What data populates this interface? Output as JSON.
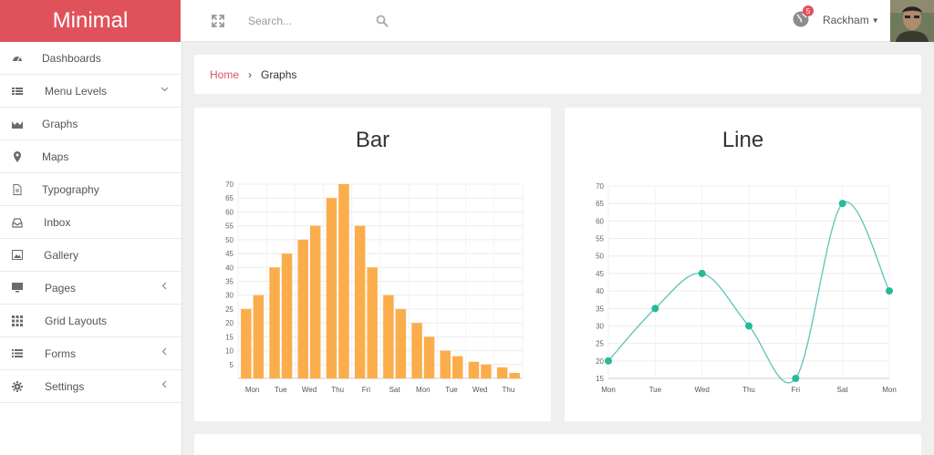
{
  "brand": {
    "title": "Minimal"
  },
  "sidebar": {
    "items": [
      {
        "label": "Dashboards",
        "icon": "dashboard-icon",
        "chevron": ""
      },
      {
        "label": "Menu Levels",
        "icon": "list-icon",
        "chevron": "⌵"
      },
      {
        "label": "Graphs",
        "icon": "area-chart-icon",
        "chevron": ""
      },
      {
        "label": "Maps",
        "icon": "map-marker-icon",
        "chevron": ""
      },
      {
        "label": "Typography",
        "icon": "file-text-icon",
        "chevron": ""
      },
      {
        "label": "Inbox",
        "icon": "inbox-icon",
        "chevron": ""
      },
      {
        "label": "Gallery",
        "icon": "picture-icon",
        "chevron": ""
      },
      {
        "label": "Pages",
        "icon": "desktop-icon",
        "chevron": "‹"
      },
      {
        "label": "Grid Layouts",
        "icon": "grid-icon",
        "chevron": ""
      },
      {
        "label": "Forms",
        "icon": "list-alt-icon",
        "chevron": "‹"
      },
      {
        "label": "Settings",
        "icon": "gear-icon",
        "chevron": "‹"
      }
    ]
  },
  "topbar": {
    "search_placeholder": "Search...",
    "notifications_count": "5",
    "user_name": "Rackham"
  },
  "breadcrumb": {
    "home": "Home",
    "current": "Graphs"
  },
  "colors": {
    "accent": "#e0525b",
    "bar": "#fbad4c",
    "line": "#5bc4b6",
    "point": "#26b99a"
  },
  "charts": [
    {
      "title": "Bar",
      "chart_data": {
        "type": "bar",
        "categories": [
          "Mon",
          "Tue",
          "Wed",
          "Thu",
          "Fri",
          "Sat",
          "Mon",
          "Tue",
          "Wed",
          "Thu"
        ],
        "series": [
          {
            "values": [
              25,
              40,
              50,
              65,
              55,
              30,
              20,
              10,
              6,
              4
            ]
          },
          {
            "values": [
              30,
              45,
              55,
              70,
              40,
              25,
              15,
              8,
              5,
              2
            ]
          }
        ],
        "yticks": [
          5,
          10,
          15,
          20,
          25,
          30,
          35,
          40,
          45,
          50,
          55,
          60,
          65,
          70
        ],
        "ylim": [
          0,
          70
        ],
        "grid": true
      }
    },
    {
      "title": "Line",
      "chart_data": {
        "type": "line",
        "categories": [
          "Mon",
          "Tue",
          "Wed",
          "Thu",
          "Fri",
          "Sat",
          "Mon"
        ],
        "series": [
          {
            "values": [
              20,
              35,
              45,
              30,
              15,
              65,
              40
            ]
          }
        ],
        "yticks": [
          15,
          20,
          25,
          30,
          35,
          40,
          45,
          50,
          55,
          60,
          65,
          70
        ],
        "ylim": [
          15,
          70
        ],
        "grid": true
      }
    }
  ]
}
